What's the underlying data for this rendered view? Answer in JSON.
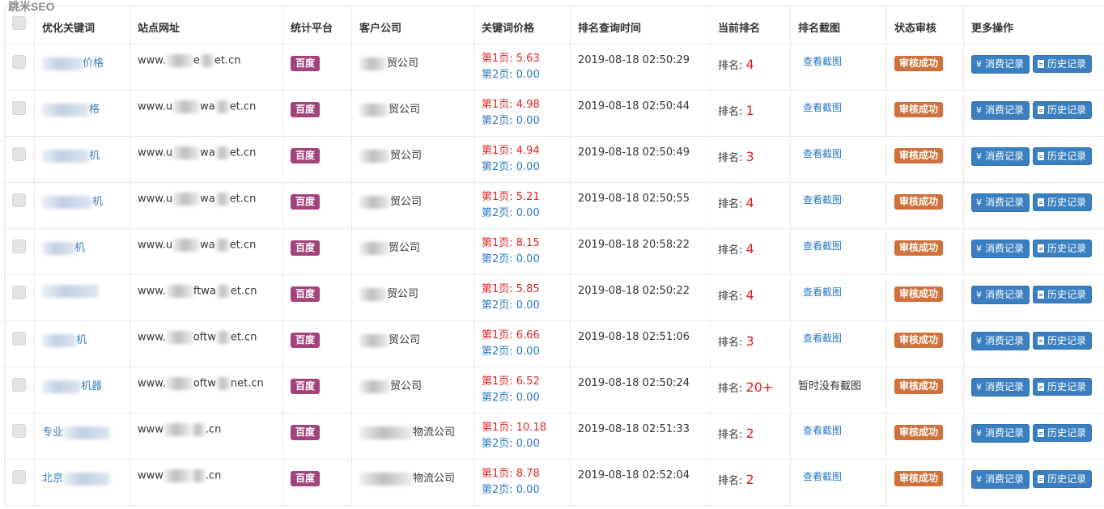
{
  "watermark": "跳米SEO",
  "columns": {
    "keyword": "优化关键词",
    "site": "站点网址",
    "platform": "统计平台",
    "company": "客户公司",
    "price": "关键词价格",
    "query_time": "排名查询时间",
    "rank": "当前排名",
    "screenshot": "排名截图",
    "status": "状态审核",
    "more": "更多操作"
  },
  "labels": {
    "rank_prefix": "排名: ",
    "view_screenshot": "查看截图",
    "no_screenshot": "暂时没有截图",
    "consume_button": "消费记录",
    "history_button": "历史记录",
    "yen_icon": "¥"
  },
  "colors": {
    "platform_badge": "#a3437d",
    "status_badge": "#d0703a",
    "action_button": "#3a7fbf",
    "price_page1": "#e02020",
    "price_page2": "#2a77c4",
    "link": "#2a77c4"
  },
  "rows": [
    {
      "kw_pre": "",
      "kw_suf": "价格",
      "url_a": "www.",
      "url_b": "e",
      "url_c": "et.cn",
      "co_suf": "贸公司",
      "platform": "百度",
      "p1": "第1页: 5.63",
      "p2": "第2页: 0.00",
      "time": "2019-08-18 02:50:29",
      "rank": "4",
      "shot": "查看截图",
      "status": "审核成功"
    },
    {
      "kw_pre": "",
      "kw_suf": "格",
      "url_a": "www.u",
      "url_b": "wa",
      "url_c": "et.cn",
      "co_suf": "贸公司",
      "platform": "百度",
      "p1": "第1页: 4.98",
      "p2": "第2页: 0.00",
      "time": "2019-08-18 02:50:44",
      "rank": "1",
      "shot": "查看截图",
      "status": "审核成功"
    },
    {
      "kw_pre": "",
      "kw_suf": "机",
      "url_a": "www.u",
      "url_b": "wa",
      "url_c": "et.cn",
      "co_suf": "贸公司",
      "platform": "百度",
      "p1": "第1页: 4.94",
      "p2": "第2页: 0.00",
      "time": "2019-08-18 02:50:49",
      "rank": "3",
      "shot": "查看截图",
      "status": "审核成功"
    },
    {
      "kw_pre": "",
      "kw_suf": "机",
      "url_a": "www.u",
      "url_b": "wa",
      "url_c": "et.cn",
      "co_suf": "贸公司",
      "platform": "百度",
      "p1": "第1页: 5.21",
      "p2": "第2页: 0.00",
      "time": "2019-08-18 02:50:55",
      "rank": "4",
      "shot": "查看截图",
      "status": "审核成功"
    },
    {
      "kw_pre": "",
      "kw_suf": "机",
      "url_a": "www.u",
      "url_b": "wa",
      "url_c": "et.cn",
      "co_suf": "贸公司",
      "platform": "百度",
      "p1": "第1页: 8.15",
      "p2": "第2页: 0.00",
      "time": "2019-08-18 20:58:22",
      "rank": "4",
      "shot": "查看截图",
      "status": "审核成功"
    },
    {
      "kw_pre": "",
      "kw_suf": "",
      "url_a": "www.",
      "url_b": "ftwa",
      "url_c": "et.cn",
      "co_suf": "贸公司",
      "platform": "百度",
      "p1": "第1页: 5.85",
      "p2": "第2页: 0.00",
      "time": "2019-08-18 02:50:22",
      "rank": "4",
      "shot": "查看截图",
      "status": "审核成功"
    },
    {
      "kw_pre": "",
      "kw_suf": "机",
      "url_a": "www.",
      "url_b": "oftw",
      "url_c": "et.cn",
      "co_suf": "贸公司",
      "platform": "百度",
      "p1": "第1页: 6.66",
      "p2": "第2页: 0.00",
      "time": "2019-08-18 02:51:06",
      "rank": "3",
      "shot": "查看截图",
      "status": "审核成功"
    },
    {
      "kw_pre": "",
      "kw_suf": "机器",
      "url_a": "www.",
      "url_b": "oftw",
      "url_c": "net.cn",
      "co_suf": "贸公司",
      "platform": "百度",
      "p1": "第1页: 6.52",
      "p2": "第2页: 0.00",
      "time": "2019-08-18 02:50:24",
      "rank": "20+",
      "shot": "",
      "status": "审核成功"
    },
    {
      "kw_pre": "专业",
      "kw_suf": "",
      "url_a": "www",
      "url_b": "",
      "url_c": ".cn",
      "co_suf": "物流公司",
      "platform": "百度",
      "p1": "第1页: 10.18",
      "p2": "第2页: 0.00",
      "time": "2019-08-18 02:51:33",
      "rank": "2",
      "shot": "查看截图",
      "status": "审核成功"
    },
    {
      "kw_pre": "北京",
      "kw_suf": "",
      "url_a": "www",
      "url_b": "",
      "url_c": ".cn",
      "co_suf": "物流公司",
      "platform": "百度",
      "p1": "第1页: 8.78",
      "p2": "第2页: 0.00",
      "time": "2019-08-18 02:52:04",
      "rank": "2",
      "shot": "查看截图",
      "status": "审核成功"
    }
  ]
}
